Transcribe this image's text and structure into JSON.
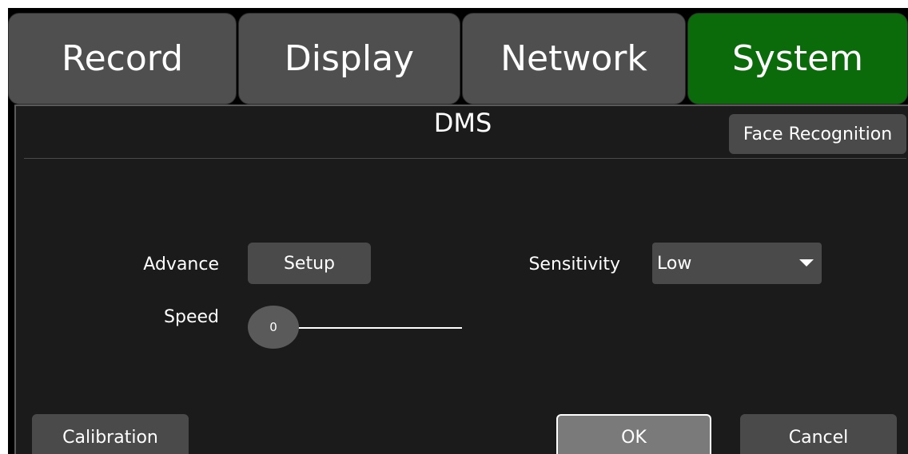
{
  "tabs": [
    {
      "label": "Record"
    },
    {
      "label": "Display"
    },
    {
      "label": "Network"
    },
    {
      "label": "System"
    }
  ],
  "active_tab": "System",
  "colors": {
    "active_tab": "#0b6b0b",
    "tab": "#4f4f4f",
    "panel": "#1b1b1b"
  },
  "panel": {
    "title": "DMS",
    "face_recognition_label": "Face Recognition"
  },
  "settings": {
    "advance_label": "Advance",
    "setup_label": "Setup",
    "sensitivity_label": "Sensitivity",
    "sensitivity_value": "Low",
    "speed_label": "Speed",
    "speed_value": "0"
  },
  "footer": {
    "calibration_label": "Calibration",
    "ok_label": "OK",
    "cancel_label": "Cancel"
  },
  "icons": {
    "dropdown": "caret-down-icon"
  }
}
